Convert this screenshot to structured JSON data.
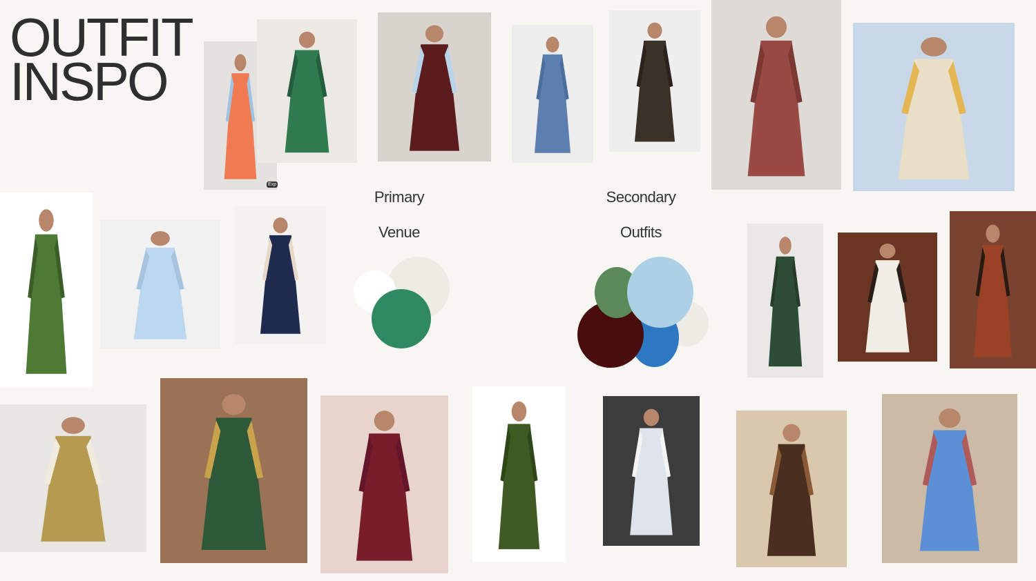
{
  "board": {
    "title_line1": "OUTFIT",
    "title_line2": "INSPO",
    "primary_label": "Primary",
    "venue_label": "Venue",
    "secondary_label": "Secondary",
    "outfits_label": "Outfits",
    "badge_text": "Exp"
  },
  "palettes": {
    "primary": [
      "#ffffff",
      "#ecebe4",
      "#2f8a62"
    ],
    "secondary": [
      "#5a8a5a",
      "#acd0e5",
      "#4a0d0d",
      "#2e78c1",
      "#ecebe4"
    ]
  },
  "photos": [
    {
      "id": "floral-maxi-dress",
      "bg": "#e4e2de",
      "garment": "#f07a52",
      "accent": "#9fc2e3"
    },
    {
      "id": "green-pleated-dress",
      "bg": "#ece9e4",
      "garment": "#2f7a4f",
      "accent": "#245e3e"
    },
    {
      "id": "burgundy-look-gloves",
      "bg": "#d8d3cd",
      "garment": "#5a1c1c",
      "accent": "#b9d4ea"
    },
    {
      "id": "blue-tulle-gown",
      "bg": "#ededed",
      "garment": "#5d7fb0",
      "accent": "#4c6e9e"
    },
    {
      "id": "brown-suit-man",
      "bg": "#eeeeee",
      "garment": "#3a3129",
      "accent": "#2b241e"
    },
    {
      "id": "rust-disc-dress",
      "bg": "#dedbd6",
      "garment": "#9a4a44",
      "accent": "#7c3832"
    },
    {
      "id": "crochet-shirt-man",
      "bg": "#c9d8e6",
      "garment": "#e9dfc6",
      "accent": "#e4b553"
    },
    {
      "id": "green-metallic-jumpsuit",
      "bg": "#ffffff",
      "garment": "#4f7a36",
      "accent": "#3b5e28"
    },
    {
      "id": "light-blue-blouse",
      "bg": "#f1f1f1",
      "garment": "#bcd8f0",
      "accent": "#a7c4de"
    },
    {
      "id": "navy-pleated-skirt",
      "bg": "#f3f2f0",
      "garment": "#1e2a4e",
      "accent": "#e7d8c8"
    },
    {
      "id": "green-suit-man",
      "bg": "#e9e8e6",
      "garment": "#2e4d36",
      "accent": "#253d2b"
    },
    {
      "id": "lace-shirt-man",
      "bg": "#6a3522",
      "garment": "#f0ede4",
      "accent": "#2b1d18"
    },
    {
      "id": "rust-striped-shirt-man",
      "bg": "#7a4330",
      "garment": "#9a4226",
      "accent": "#2a1a14"
    },
    {
      "id": "knit-polo-man",
      "bg": "#e8e6e3",
      "garment": "#b59a4f",
      "accent": "#f0ebdd"
    },
    {
      "id": "sequin-chevron-dress",
      "bg": "#9a7356",
      "garment": "#2f5a3a",
      "accent": "#c9a24c"
    },
    {
      "id": "burgundy-gown",
      "bg": "#e7d5cd",
      "garment": "#7a1d2b",
      "accent": "#65162a"
    },
    {
      "id": "green-velvet-suit",
      "bg": "#ffffff",
      "garment": "#3f5a22",
      "accent": "#2f4618"
    },
    {
      "id": "pale-suit-man",
      "bg": "#3c3c3c",
      "garment": "#dfe4ea",
      "accent": "#f4f4f4"
    },
    {
      "id": "brown-trousers-balcony",
      "bg": "#d9c8ad",
      "garment": "#4a2e1f",
      "accent": "#8a5a36"
    },
    {
      "id": "blue-suit-man",
      "bg": "#cbbba6",
      "garment": "#5b8fd6",
      "accent": "#b05a5a"
    }
  ]
}
